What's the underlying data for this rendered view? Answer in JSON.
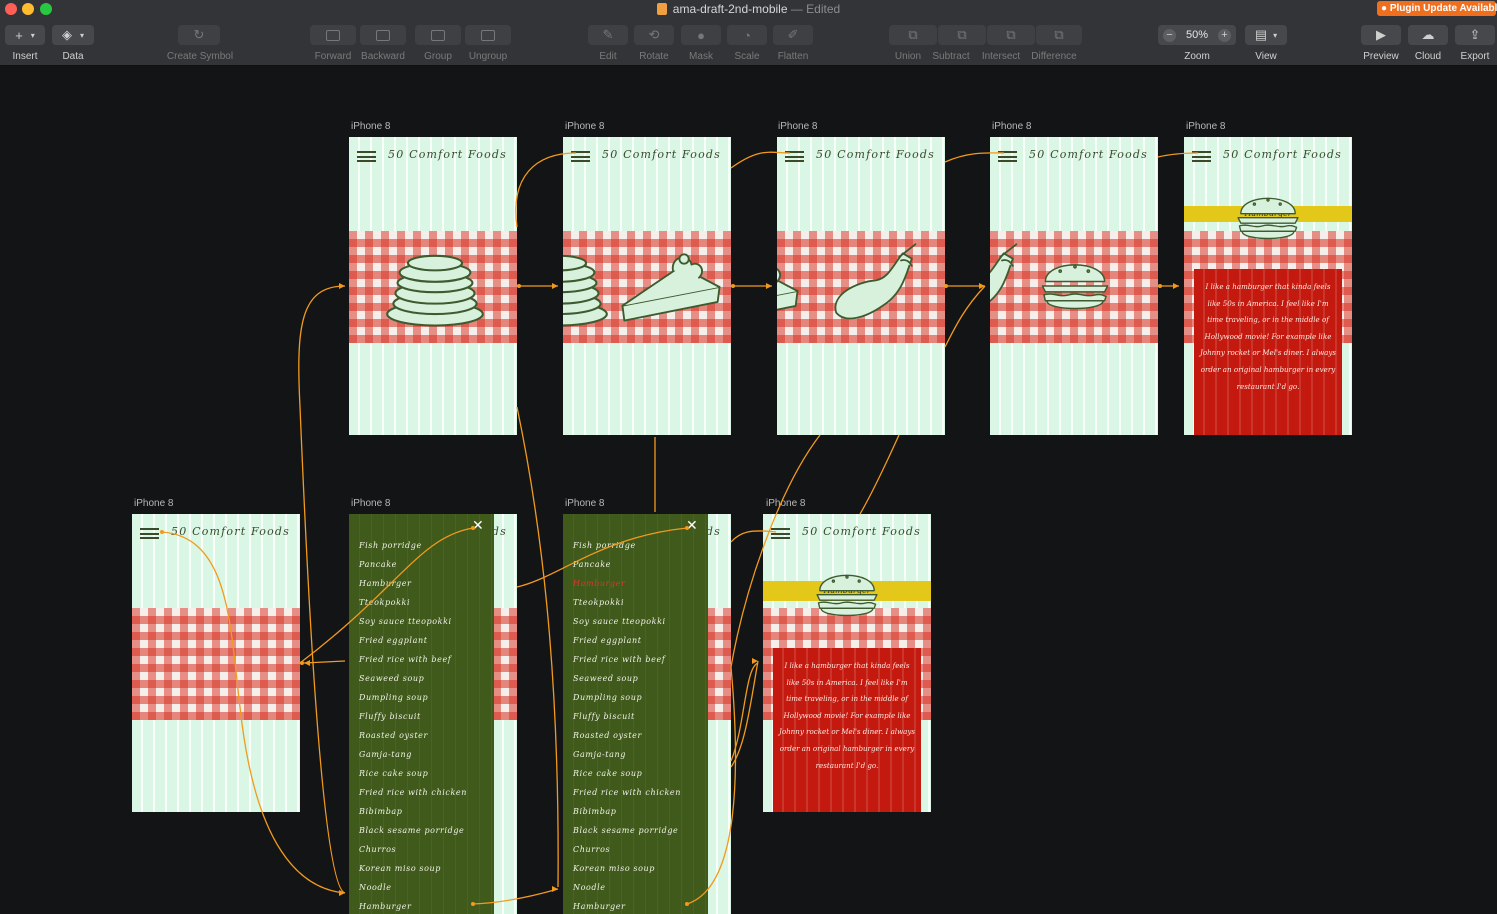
{
  "window": {
    "title": "ama-draft-2nd-mobile",
    "edited": "— Edited",
    "plugin_badge": "● Plugin Update Available",
    "traffic": [
      "#fe5f57",
      "#febc2e",
      "#28c840"
    ]
  },
  "toolbar": {
    "insert": "Insert",
    "data": "Data",
    "create_symbol": "Create Symbol",
    "forward": "Forward",
    "backward": "Backward",
    "group": "Group",
    "ungroup": "Ungroup",
    "edit": "Edit",
    "rotate": "Rotate",
    "mask": "Mask",
    "scale": "Scale",
    "flatten": "Flatten",
    "union": "Union",
    "subtract": "Subtract",
    "intersect": "Intersect",
    "difference": "Difference",
    "zoom_label": "Zoom",
    "zoom_value": "50%",
    "zoom_minus": "−",
    "zoom_plus": "+",
    "view": "View",
    "preview": "Preview",
    "cloud": "Cloud",
    "export": "Export"
  },
  "artboards": {
    "label": "iPhone 8",
    "app_title": "50 Comfort Foods",
    "close_glyph": "✕",
    "food_banner": "Hamburger",
    "hamburger_text": "I like a hamburger that kinda feels like 50s in America. I feel like I'm time traveling, or in the middle of Hollywood movie! For example like Johnny rocket or Mel's diner. I always order an original hamburger in every restaurant I'd go.",
    "menu_items": [
      "Fish porridge",
      "Pancake",
      "Hamburger",
      "Tteokpokki",
      "Soy sauce tteopokki",
      "Fried eggplant",
      "Fried rice with beef",
      "Seaweed soup",
      "Dumpling soup",
      "Fluffy biscuit",
      "Roasted oyster",
      "Gamja-tang",
      "Rice cake soup",
      "Fried rice with chicken",
      "Bibimbap",
      "Black sesame porridge",
      "Churros",
      "Korean miso soup",
      "Noodle",
      "Hamburger"
    ]
  },
  "colors": {
    "canvas": "#131416",
    "mint": "#d9f7e4",
    "gingham_red": "#d63022",
    "menu_green": "#3f5a1b",
    "banner_yellow": "#e3c81a",
    "desc_red": "#c3190f",
    "prototype_link": "#f29a1e",
    "accent": "#ef6f1f"
  }
}
